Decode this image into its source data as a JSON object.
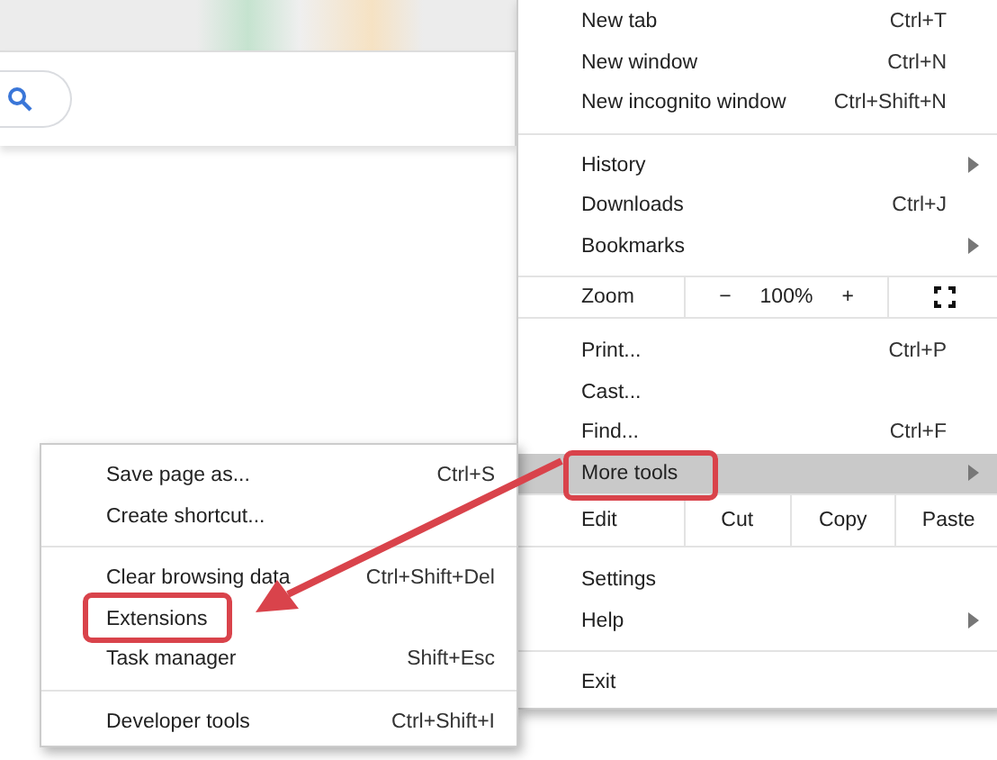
{
  "main_menu": {
    "sections": [
      [
        {
          "kind": "item",
          "label": "New tab",
          "shortcut": "Ctrl+T"
        },
        {
          "kind": "item",
          "label": "New window",
          "shortcut": "Ctrl+N"
        },
        {
          "kind": "item",
          "label": "New incognito window",
          "shortcut": "Ctrl+Shift+N"
        }
      ],
      [
        {
          "kind": "item",
          "label": "History",
          "submenu": true
        },
        {
          "kind": "item",
          "label": "Downloads",
          "shortcut": "Ctrl+J"
        },
        {
          "kind": "item",
          "label": "Bookmarks",
          "submenu": true
        }
      ],
      [
        {
          "kind": "zoom",
          "label": "Zoom",
          "minus": "−",
          "value": "100%",
          "plus": "+"
        }
      ],
      [
        {
          "kind": "item",
          "label": "Print...",
          "shortcut": "Ctrl+P"
        },
        {
          "kind": "item",
          "label": "Cast..."
        },
        {
          "kind": "item",
          "label": "Find...",
          "shortcut": "Ctrl+F"
        },
        {
          "kind": "item",
          "label": "More tools",
          "submenu": true,
          "selected": true,
          "annotated": true
        }
      ],
      [
        {
          "kind": "edit",
          "label": "Edit",
          "actions": [
            "Cut",
            "Copy",
            "Paste"
          ]
        }
      ],
      [
        {
          "kind": "item",
          "label": "Settings"
        },
        {
          "kind": "item",
          "label": "Help",
          "submenu": true
        }
      ],
      [
        {
          "kind": "item",
          "label": "Exit"
        }
      ]
    ]
  },
  "sub_menu": {
    "sections": [
      [
        {
          "kind": "item",
          "label": "Save page as...",
          "shortcut": "Ctrl+S"
        },
        {
          "kind": "item",
          "label": "Create shortcut..."
        }
      ],
      [
        {
          "kind": "item",
          "label": "Clear browsing data",
          "shortcut": "Ctrl+Shift+Del"
        },
        {
          "kind": "item",
          "label": "Extensions",
          "annotated": true
        },
        {
          "kind": "item",
          "label": "Task manager",
          "shortcut": "Shift+Esc"
        }
      ],
      [
        {
          "kind": "item",
          "label": "Developer tools",
          "shortcut": "Ctrl+Shift+I"
        }
      ]
    ]
  }
}
